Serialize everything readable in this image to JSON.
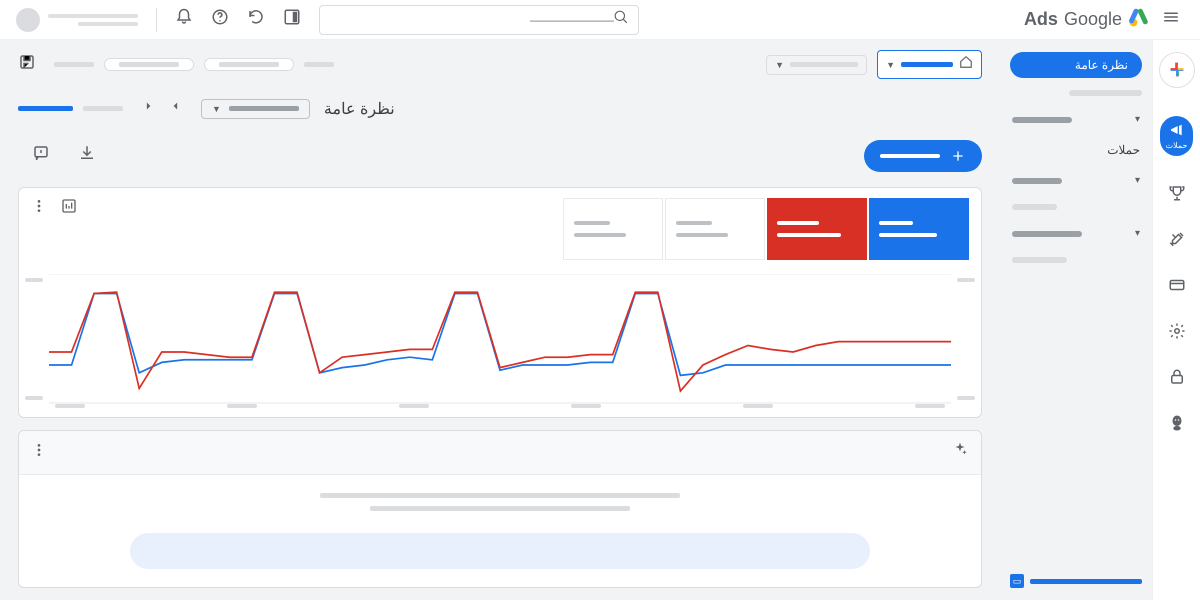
{
  "header": {
    "logo_word1": "Google",
    "logo_word2": "Ads",
    "search_placeholder": "———————"
  },
  "sidebar": {
    "primary_button": "نظرة عامة",
    "campaigns_label": "حملات"
  },
  "page": {
    "title": "نظرة عامة"
  },
  "chart_data": {
    "type": "line",
    "title": "",
    "x": [
      0,
      1,
      2,
      3,
      4,
      5,
      6,
      7,
      8,
      9,
      10,
      11,
      12,
      13,
      14,
      15,
      16,
      17,
      18,
      19,
      20,
      21,
      22,
      23,
      24,
      25,
      26,
      27,
      28,
      29,
      30,
      31,
      32,
      33,
      34,
      35,
      36,
      37,
      38,
      39,
      40
    ],
    "series": [
      {
        "name": "blue",
        "color": "#1a73e8",
        "values": [
          30,
          30,
          85,
          85,
          24,
          32,
          34,
          34,
          34,
          34,
          85,
          85,
          24,
          28,
          30,
          34,
          36,
          34,
          85,
          85,
          26,
          30,
          30,
          30,
          32,
          32,
          85,
          85,
          22,
          24,
          30,
          30,
          30,
          30,
          30,
          30,
          30,
          30,
          30,
          30,
          30
        ]
      },
      {
        "name": "red",
        "color": "#d93025",
        "values": [
          40,
          40,
          85,
          86,
          12,
          40,
          40,
          38,
          36,
          36,
          86,
          86,
          24,
          36,
          38,
          40,
          42,
          42,
          86,
          86,
          28,
          32,
          36,
          36,
          38,
          38,
          86,
          86,
          10,
          30,
          38,
          45,
          42,
          40,
          45,
          48,
          48,
          48,
          48,
          48,
          48
        ]
      }
    ],
    "ylim": [
      0,
      100
    ],
    "xlabel": "",
    "ylabel": ""
  }
}
